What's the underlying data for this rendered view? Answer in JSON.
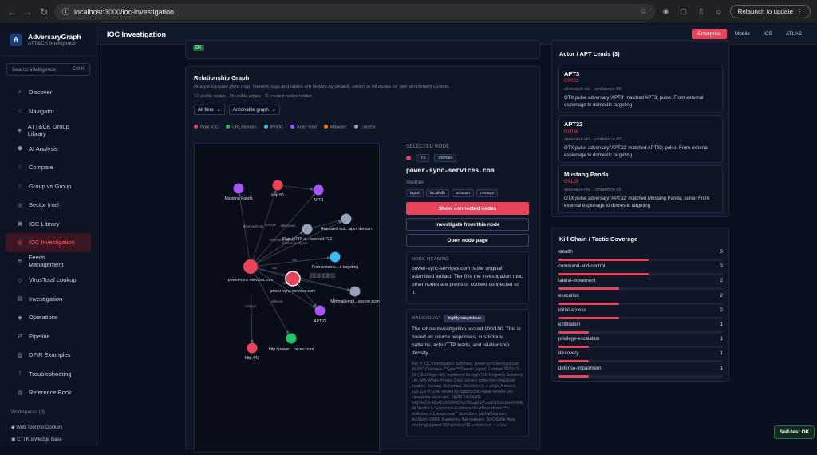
{
  "browser": {
    "url": "localhost:3000/ioc-investigation",
    "relaunch": "Relaunch to update"
  },
  "brand": {
    "name": "AdversaryGraph",
    "tagline": "ATT&CK Intelligence"
  },
  "search": {
    "placeholder": "Search intelligence",
    "shortcut": "Ctrl K"
  },
  "nav": [
    {
      "label": "Discover",
      "icon": "search-icon",
      "glyph": "⌕"
    },
    {
      "label": "Navigator",
      "icon": "navigator-icon",
      "glyph": "○"
    },
    {
      "label": "ATT&CK Group Library",
      "icon": "library-icon",
      "glyph": "◈"
    },
    {
      "label": "AI Analysis",
      "icon": "ai-icon",
      "glyph": "⬢"
    },
    {
      "label": "Compare",
      "icon": "compare-icon",
      "glyph": "○"
    },
    {
      "label": "Group vs Group",
      "icon": "versus-icon",
      "glyph": "○"
    },
    {
      "label": "Sector Intel",
      "icon": "sector-icon",
      "glyph": "◎"
    },
    {
      "label": "IOC Library",
      "icon": "ioc-library-icon",
      "glyph": "▣"
    },
    {
      "label": "IOC Investigation",
      "icon": "investigation-icon",
      "glyph": "◎"
    },
    {
      "label": "Feeds Management",
      "icon": "feeds-icon",
      "glyph": "≋"
    },
    {
      "label": "VirusTotal Lookup",
      "icon": "virustotal-icon",
      "glyph": "◇"
    },
    {
      "label": "Investigation",
      "icon": "folder-icon",
      "glyph": "▤"
    },
    {
      "label": "Operations",
      "icon": "operations-icon",
      "glyph": "◆"
    },
    {
      "label": "Pipeline",
      "icon": "pipeline-icon",
      "glyph": "⇄"
    },
    {
      "label": "DFIR Examples",
      "icon": "dfir-icon",
      "glyph": "▥"
    },
    {
      "label": "Troubleshooting",
      "icon": "alert-icon",
      "glyph": "!"
    },
    {
      "label": "Reference Book",
      "icon": "book-icon",
      "glyph": "▤"
    }
  ],
  "workspaces": {
    "label": "Workspaces (0)",
    "items": [
      "Web Tool (no Docker)",
      "CTI Knowledge Base"
    ]
  },
  "page": {
    "title": "IOC Investigation",
    "status": "OK"
  },
  "domains": [
    "Enterprise",
    "Mobile",
    "ICS",
    "ATLAS"
  ],
  "graph": {
    "title": "Relationship Graph",
    "description": "Analyst-focused pivot map. Generic tags and labels are hidden by default; switch to All nodes for raw enrichment context.",
    "counts": "12 visible nodes · 15 visible edges · 11 context nodes hidden",
    "tier_select": "All tiers",
    "mode_select": "Actionable graph",
    "legend": [
      {
        "label": "Root IOC",
        "color": "#e8435a"
      },
      {
        "label": "URL/domain",
        "color": "#22c55e"
      },
      {
        "label": "IP/IOC",
        "color": "#38bdf8"
      },
      {
        "label": "Actor lead",
        "color": "#a855f7"
      },
      {
        "label": "Malware",
        "color": "#f97316"
      },
      {
        "label": "Context",
        "color": "#94a3b8"
      }
    ],
    "node_labels": {
      "mustang": "Mustang Panda",
      "http80": "http:80",
      "apt3": "APT3",
      "repeated": "Repeated aut…apex domain",
      "plain": "Plain HTTP a…bserved TLS",
      "external": "From externa…c targeting",
      "root": "power-sync-services.com",
      "selected": "power-sync-services.com",
      "minimal": "Minimal/empt…ses on scan",
      "apt32": "APT32",
      "http443": "http:443",
      "url": "http://power…rvices.com/"
    },
    "edge_labels": {
      "alienvault": "alienvault",
      "censys": "censys",
      "urlscan": "urlscan",
      "urlscan_analysis": "urlscan-analysis",
      "otx": "otx",
      "alienvault_otx": "alienvault-otx"
    }
  },
  "selected_node": {
    "heading": "SELECTED NODE",
    "tier": "T0",
    "type": "domain",
    "name": "power-sync-services.com",
    "sources_label": "Sources",
    "sources": [
      "input",
      "local-db",
      "urlscan",
      "censys"
    ],
    "buttons": {
      "show": "Show connected nodes",
      "investigate": "Investigate from this node",
      "open": "Open node page"
    },
    "meaning_label": "NODE MEANING",
    "meaning": "power-sync-services.com is the original submitted artifact. Tier 0 is the investigation root; other nodes are pivots or context connected to it.",
    "verdict_label": "MALICIOUS?",
    "verdict": "highly suspicious",
    "verdict_text": "The whole investigation scored 100/100. This is based on source responses, suspicious patterns, actor/TTP leads, and relationship density.",
    "ref": "Ref: # IOC Investigation Summary: power-sync-services.com ## IOC Overview **Type:** Domain (apex). Created 2023-12-13 (~810 days old), registered through TLD Registrar Solutions Ltd. with Whois Privacy Corp. privacy protection (registrant location: Nassau, Bahamas). Resolves to a single A record, 103.118.47.104, served by tcpdns.com name servers (ns-canada/ns-uk.cn-sm). JARM 14d14d00 14d14d16c42d42d00000005d7f90ab2f97cad8f12b0d9d40064ll. ## Verdict & Suspicious Evidence VirusTotal shows **5 malicious + 1 suspicious** detections (alphaMountain, ArcSight, CRDF, Kaspersky flag malware; SOCRadar flags phishing) against 53 harmless/32 undetected — a low"
  },
  "actors": {
    "title": "Actor / APT Leads (3)",
    "items": [
      {
        "name": "APT3",
        "id": "G0022",
        "meta": "alienvault-otx · confidence 80",
        "desc": "OTX pulse adversary 'APT3' matched APT3; pulse: From external espionage to domestic targeting"
      },
      {
        "name": "APT32",
        "id": "G0050",
        "meta": "alienvault-otx · confidence 80",
        "desc": "OTX pulse adversary 'APT32' matched APT32; pulse: From external espionage to domestic targeting"
      },
      {
        "name": "Mustang Panda",
        "id": "G0129",
        "meta": "alienvault-otx · confidence 65",
        "desc": "OTX pulse adversary 'APT32' matched Mustang Panda; pulse: From external espionage to domestic targeting"
      }
    ]
  },
  "killchain": {
    "title": "Kill Chain / Tactic Coverage",
    "max": 3,
    "items": [
      {
        "name": "stealth",
        "count": 3
      },
      {
        "name": "command-and-control",
        "count": 3
      },
      {
        "name": "lateral-movement",
        "count": 2
      },
      {
        "name": "execution",
        "count": 2
      },
      {
        "name": "initial-access",
        "count": 2
      },
      {
        "name": "exfiltration",
        "count": 1
      },
      {
        "name": "privilege-escalation",
        "count": 1
      },
      {
        "name": "discovery",
        "count": 1
      },
      {
        "name": "defense-impairment",
        "count": 1
      }
    ]
  },
  "selftest": "Self-test OK"
}
